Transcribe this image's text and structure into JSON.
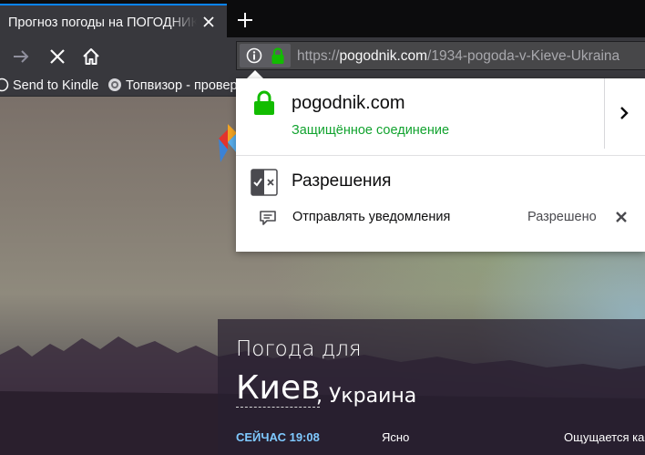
{
  "tab": {
    "title": "Прогноз погоды на ПОГОДНИК"
  },
  "urlbar": {
    "url_prefix": "https://",
    "url_host": "pogodnik.com",
    "url_path": "/1934-pogoda-v-Kieve-Ukraina"
  },
  "bookmarks": [
    {
      "label": "Send to Kindle",
      "icon": "kindle-icon"
    },
    {
      "label": "Топвизор - провер",
      "icon": "globe-icon"
    }
  ],
  "popup": {
    "host": "pogodnik.com",
    "connection": "Защищённое соединение",
    "permissions_title": "Разрешения",
    "permission": {
      "label": "Отправлять уведомления",
      "state": "Разрешено"
    }
  },
  "weather": {
    "title": "Погода для",
    "city": "Киев",
    "country": ", Украина",
    "now": "СЕЙЧАС 19:08",
    "condition": "Ясно",
    "feels": "Ощущается как"
  },
  "colors": {
    "accent_tab": "#0a84ff",
    "lock_green": "#12a32f",
    "now_blue": "#7fc9ff"
  }
}
